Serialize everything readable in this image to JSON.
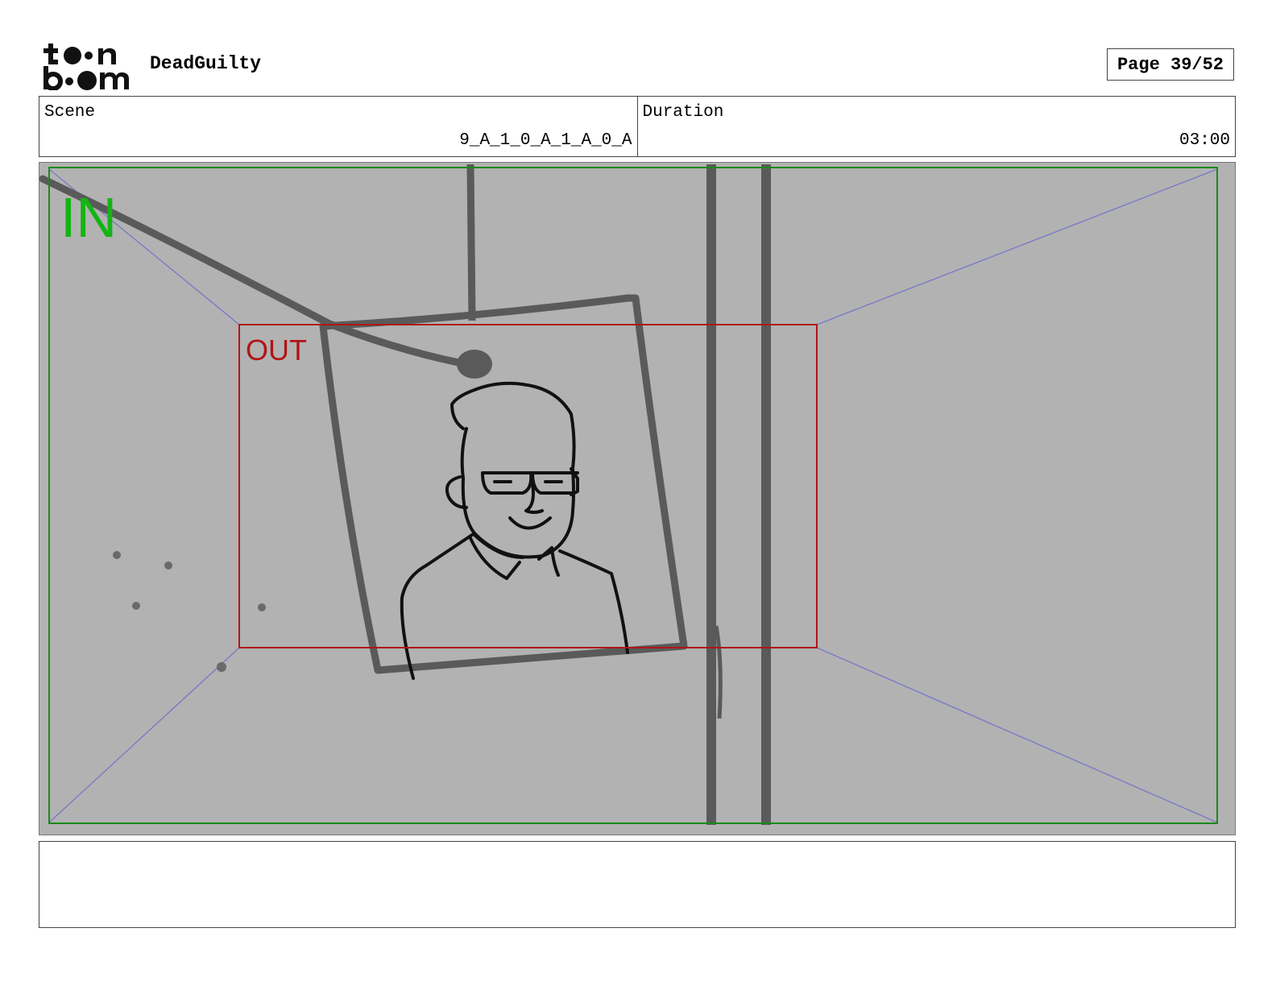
{
  "header": {
    "logo": {
      "line1": "toon",
      "line2": "boom"
    },
    "project_title": "DeadGuilty",
    "page_label": "Page 39/52"
  },
  "scene_info": {
    "scene_label": "Scene",
    "scene_value": "9_A_1_0_A_1_A_0_A",
    "duration_label": "Duration",
    "duration_value": "03:00"
  },
  "panel": {
    "in_label": "IN",
    "out_label": "OUT",
    "colors": {
      "in_frame": "#1a8a1a",
      "in_text": "#14b414",
      "out_frame": "#b01515",
      "perspective": "#7a7ac8",
      "background": "#b2b2b2"
    }
  },
  "notes": {
    "text": ""
  }
}
